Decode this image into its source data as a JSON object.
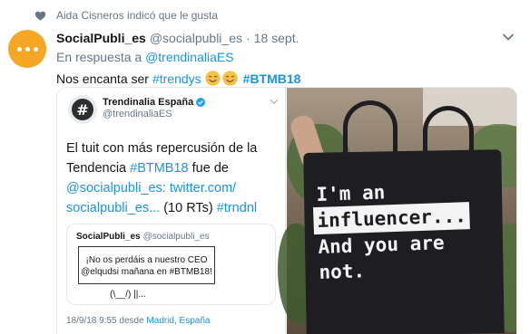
{
  "social_context": {
    "text": "Aida Cisneros indicó que le gusta"
  },
  "tweet": {
    "name": "SocialPubli_es",
    "handle": "@socialpubli_es",
    "separator": "·",
    "date": "18 sept.",
    "reply_prefix": "En respuesta a",
    "reply_to": "@trendinaliaES",
    "text_prefix": "Nos encanta ser",
    "hashtag_1": "#trendys",
    "hashtag_2": "#BTMB18"
  },
  "quoted_tweet": {
    "name": "Trendinalia España",
    "handle": "@trendinaliaES",
    "line1": "El tuit con más repercusión de la",
    "line2_a": "Tendencia",
    "line2_b": "#BTMB18",
    "line2_c": "fue de",
    "line3": "@socialpubli_es: twitter.com/",
    "line4_a": "socialpubli_es...",
    "line4_b": "(10 RTs)",
    "line4_c": "#trndnl",
    "inner_quote": {
      "name": "SocialPubli_es",
      "handle": "@socialpubli_es",
      "box_line1": "¡No os perdáis a nuestro CEO",
      "box_line2": "@elqudsi mañana en #BTMB18!",
      "footer": "(\\__/) ||..."
    },
    "meta_prefix": "18/9/18 9:55 desde",
    "meta_place": "Madrid, España"
  },
  "photo": {
    "bag_line1": "I'm an",
    "bag_line2": "influencer...",
    "bag_line3": "And you are",
    "bag_line4": "not."
  },
  "colors": {
    "link": "#1b95e0",
    "avatar": "#f5a623",
    "muted": "#657786"
  }
}
